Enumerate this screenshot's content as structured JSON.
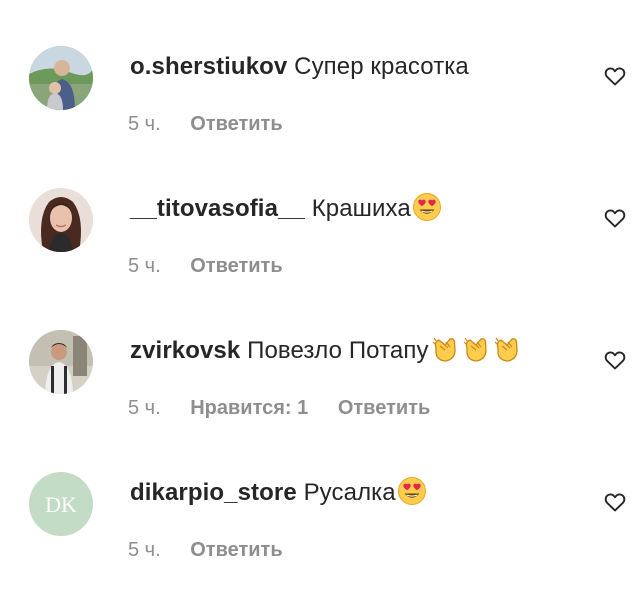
{
  "comments": [
    {
      "username": "o.sherstiukov",
      "text": "Супер красотка",
      "emojis": [],
      "time": "5 ч.",
      "likes_label": "",
      "reply_label": "Ответить",
      "avatar_icon": "profile-photo-man-child"
    },
    {
      "username": "__titovasofia__",
      "text": "Крашиха",
      "emojis": [
        "heart-eyes-emoji"
      ],
      "time": "5 ч.",
      "likes_label": "",
      "reply_label": "Ответить",
      "avatar_icon": "profile-photo-woman"
    },
    {
      "username": "zvirkovsk",
      "text": "Повезло Потапу",
      "emojis": [
        "clapping-hands-emoji",
        "clapping-hands-emoji",
        "clapping-hands-emoji"
      ],
      "time": "5 ч.",
      "likes_label": "Нравится: 1",
      "reply_label": "Ответить",
      "avatar_icon": "profile-photo-man"
    },
    {
      "username": "dikarpio_store",
      "text": "Русалка",
      "emojis": [
        "heart-eyes-emoji"
      ],
      "time": "5 ч.",
      "likes_label": "",
      "reply_label": "Ответить",
      "avatar_icon": "brand-logo-dk",
      "avatar_logo_text": "DK"
    }
  ],
  "colors": {
    "text": "#262626",
    "secondary": "#8e8e8e",
    "dk_logo_bg": "#c3dcc5"
  },
  "icons": {
    "like": "heart-outline-icon"
  }
}
